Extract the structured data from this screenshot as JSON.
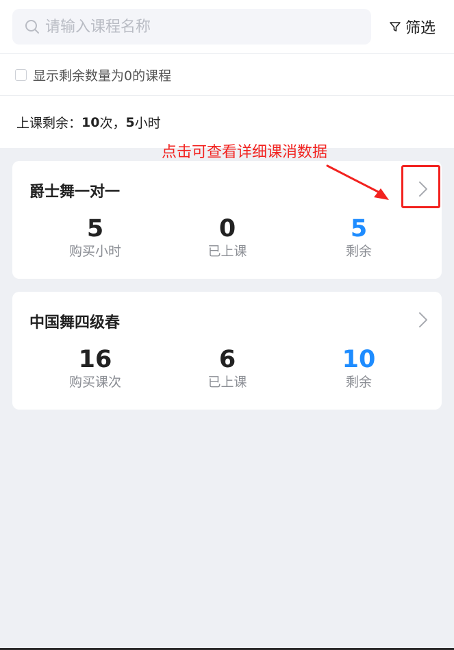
{
  "search": {
    "placeholder": "请输入课程名称"
  },
  "filter": {
    "label": "筛选"
  },
  "show_zero": {
    "label": "显示剩余数量为0的课程",
    "checked": false
  },
  "remaining": {
    "prefix": "上课剩余：",
    "count": "10",
    "count_unit": "次，",
    "hours": "5",
    "hours_unit": "小时"
  },
  "annotation": {
    "text": "点击可查看详细课消数据",
    "color": "#f2221f"
  },
  "accent_color": "#1e8cff",
  "courses": [
    {
      "title": "爵士舞一对一",
      "stats": [
        {
          "value": "5",
          "label": "购买小时"
        },
        {
          "value": "0",
          "label": "已上课"
        },
        {
          "value": "5",
          "label": "剩余"
        }
      ]
    },
    {
      "title": "中国舞四级春",
      "stats": [
        {
          "value": "16",
          "label": "购买课次"
        },
        {
          "value": "6",
          "label": "已上课"
        },
        {
          "value": "10",
          "label": "剩余"
        }
      ]
    }
  ]
}
